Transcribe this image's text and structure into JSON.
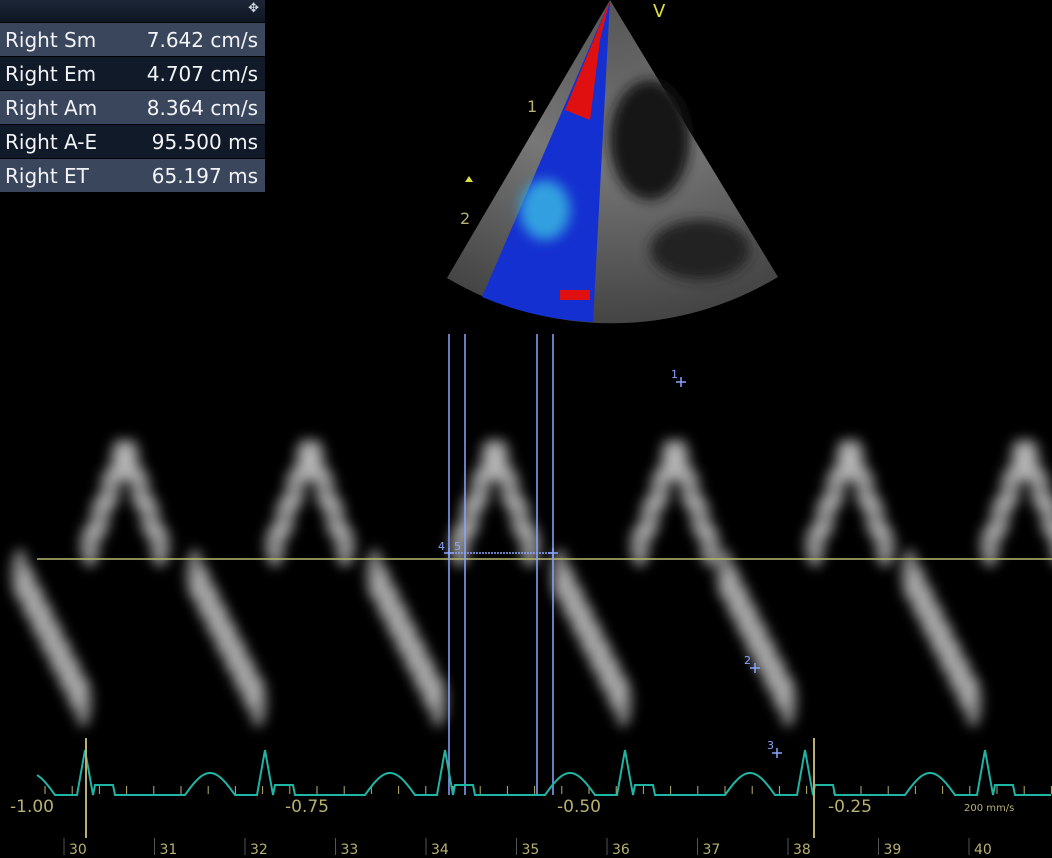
{
  "measurements": {
    "move_icon": "move-icon",
    "rows": [
      {
        "label": "Right Sm",
        "value": "7.642 cm/s"
      },
      {
        "label": "Right Em",
        "value": "4.707 cm/s"
      },
      {
        "label": "Right Am",
        "value": "8.364 cm/s"
      },
      {
        "label": "Right A-E",
        "value": "95.500 ms"
      },
      {
        "label": "Right ET",
        "value": "65.197 ms"
      }
    ]
  },
  "sector": {
    "orient_label": "V",
    "depth_marks": [
      "1",
      "2"
    ]
  },
  "markers": [
    "1",
    "2",
    "3",
    "4",
    "5"
  ],
  "time_axis": [
    "-1.00",
    "-0.75",
    "-0.50",
    "-0.25"
  ],
  "sweep_speed": "200 mm/s",
  "ruler": [
    "30",
    "31",
    "32",
    "33",
    "34",
    "35",
    "36",
    "37",
    "38",
    "39",
    "40"
  ],
  "colors": {
    "baseline": "#b8b870",
    "ecg": "#1fb5a5",
    "calipers": "#8aa6ff"
  }
}
